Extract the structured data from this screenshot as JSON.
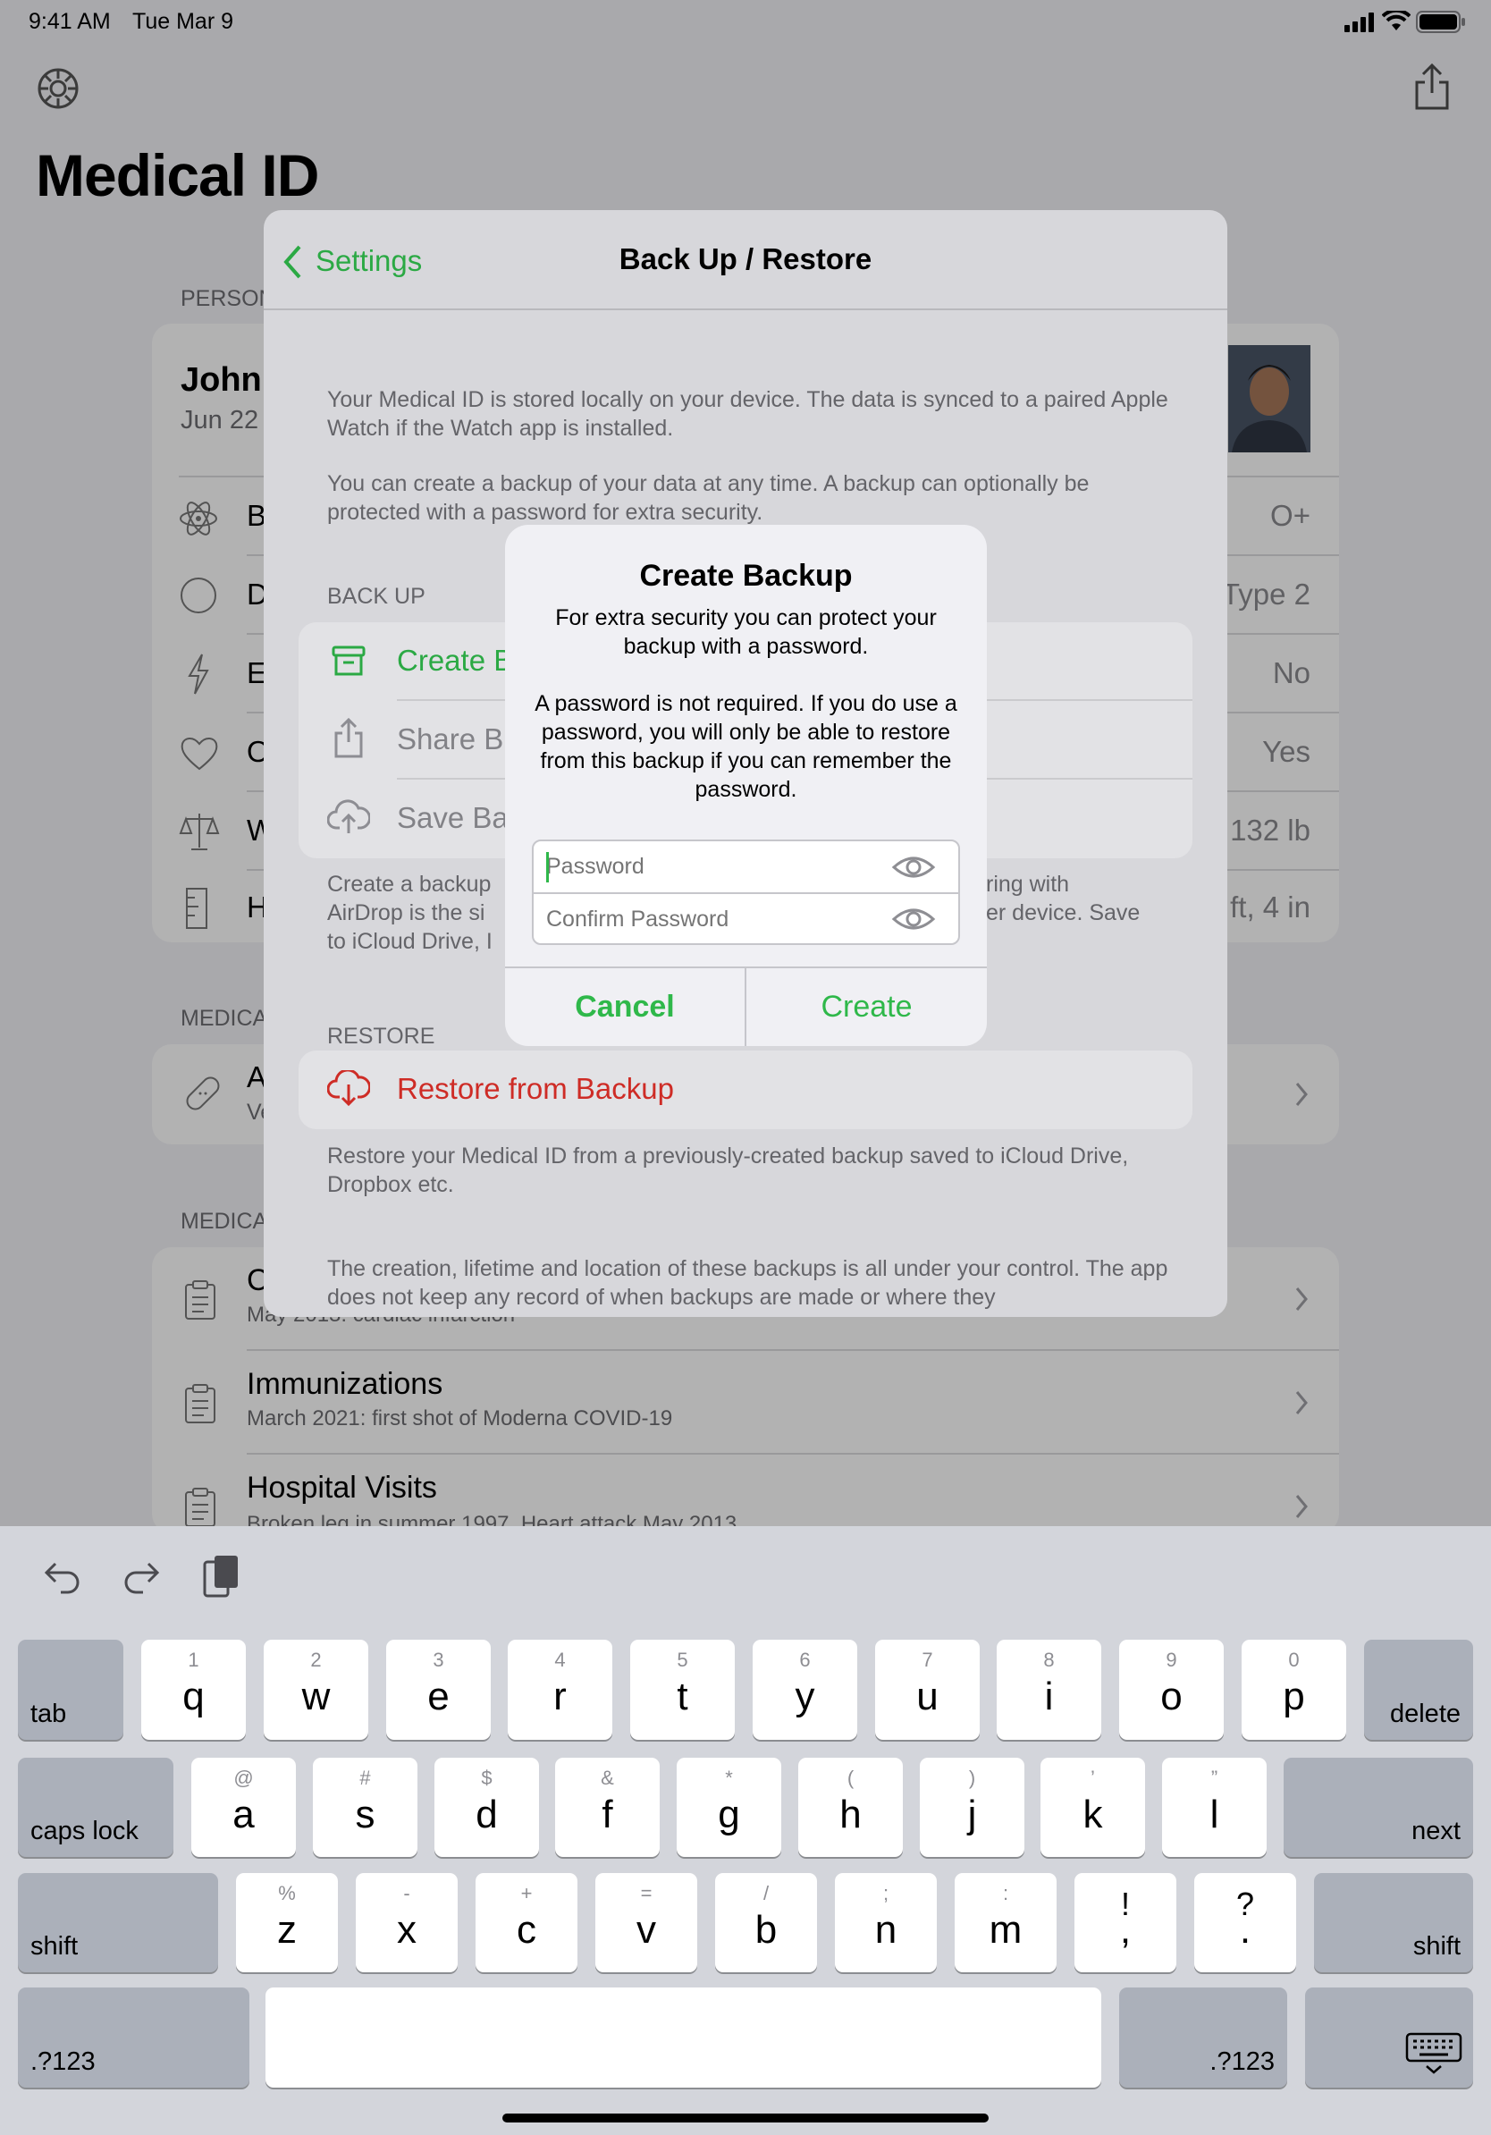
{
  "status": {
    "time": "9:41 AM",
    "date": "Tue Mar 9"
  },
  "background": {
    "title": "Medical ID",
    "personal_label": "PERSON",
    "person_name": "John",
    "person_dob": "Jun 22",
    "rows": [
      {
        "label": "B",
        "value": "O+",
        "icon": "atom-icon"
      },
      {
        "label": "D",
        "value": "Type 2",
        "icon": "circle-icon"
      },
      {
        "label": "E",
        "value": "No",
        "icon": "bolt-icon"
      },
      {
        "label": "O",
        "value": "Yes",
        "icon": "heart-icon"
      },
      {
        "label": "W",
        "value": "132 lb",
        "icon": "scale-icon"
      },
      {
        "label": "H",
        "value": "ft, 4 in",
        "icon": "ruler-icon"
      }
    ],
    "medical_label_1": "MEDICA",
    "allergy_label": "A",
    "allergy_sub": "Ve",
    "medical_label_2": "MEDICA",
    "history": [
      {
        "title": "C",
        "sub": "May 2013: cardiac infarction"
      },
      {
        "title": "Immunizations",
        "sub": "March 2021: first shot of Moderna COVID-19"
      },
      {
        "title": "Hospital Visits",
        "sub": "Broken leg in summer 1997. Heart attack May 2013."
      }
    ]
  },
  "sheet": {
    "back_label": "Settings",
    "title": "Back Up / Restore",
    "intro_1": "Your Medical ID is stored locally on your device. The data is synced to a paired Apple Watch if the Watch app is installed.",
    "intro_2": "You can create a backup of your data at any time. A backup can optionally be protected with a password for extra security.",
    "backup_header": "BACK UP",
    "backup_items": [
      "Create B",
      "Share B",
      "Save Ba"
    ],
    "backup_note_l1": "Create a backup",
    "backup_note_l2": "AirDrop is the si",
    "backup_note_l3": "to iCloud Drive, I",
    "backup_note_r1": "ring with",
    "backup_note_r2": "er device. Save",
    "restore_header": "RESTORE",
    "restore_item": "Restore from Backup",
    "restore_note": "Restore your Medical ID from a previously-created backup saved to iCloud Drive, Dropbox etc.",
    "control_note": "The creation, lifetime and location of these backups is all under your control. The app does not keep any record of when backups are made or where they"
  },
  "alert": {
    "title": "Create Backup",
    "message_1": "For extra security you can protect your backup with a password.",
    "message_2": "A password is not required. If you do use a password, you will only be able to restore from this backup if you can remember the password.",
    "password_placeholder": "Password",
    "confirm_placeholder": "Confirm Password",
    "cancel": "Cancel",
    "create": "Create"
  },
  "keyboard": {
    "row1": [
      {
        "k": "q",
        "s": "1"
      },
      {
        "k": "w",
        "s": "2"
      },
      {
        "k": "e",
        "s": "3"
      },
      {
        "k": "r",
        "s": "4"
      },
      {
        "k": "t",
        "s": "5"
      },
      {
        "k": "y",
        "s": "6"
      },
      {
        "k": "u",
        "s": "7"
      },
      {
        "k": "i",
        "s": "8"
      },
      {
        "k": "o",
        "s": "9"
      },
      {
        "k": "p",
        "s": "0"
      }
    ],
    "row2": [
      {
        "k": "a",
        "s": "@"
      },
      {
        "k": "s",
        "s": "#"
      },
      {
        "k": "d",
        "s": "$"
      },
      {
        "k": "f",
        "s": "&"
      },
      {
        "k": "g",
        "s": "*"
      },
      {
        "k": "h",
        "s": "("
      },
      {
        "k": "j",
        "s": ")"
      },
      {
        "k": "k",
        "s": "’"
      },
      {
        "k": "l",
        "s": "”"
      }
    ],
    "row3": [
      {
        "k": "z",
        "s": "%"
      },
      {
        "k": "x",
        "s": "-"
      },
      {
        "k": "c",
        "s": "+"
      },
      {
        "k": "v",
        "s": "="
      },
      {
        "k": "b",
        "s": "/"
      },
      {
        "k": "n",
        "s": ";"
      },
      {
        "k": "m",
        "s": ":"
      },
      {
        "k": ",",
        "s": "!"
      },
      {
        "k": ".",
        "s": "?"
      }
    ],
    "tab": "tab",
    "delete": "delete",
    "caps": "caps lock",
    "next": "next",
    "shift": "shift",
    "numbers": ".?123"
  }
}
